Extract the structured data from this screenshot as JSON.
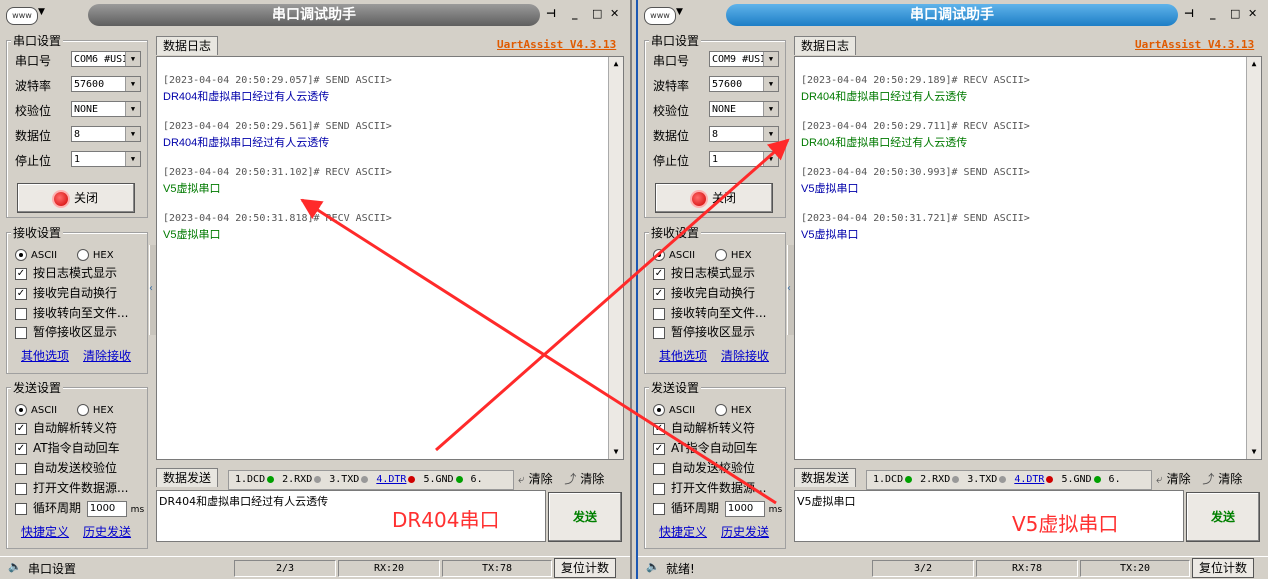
{
  "windows": {
    "left": {
      "title": "串口调试助手",
      "brand": "UartAssist V4.3.13",
      "serial": {
        "group": "串口设置",
        "port_label": "串口号",
        "port": "COM6 #USI",
        "baud_label": "波特率",
        "baud": "57600",
        "parity_label": "校验位",
        "parity": "NONE",
        "databits_label": "数据位",
        "databits": "8",
        "stopbits_label": "停止位",
        "stopbits": "1",
        "close_label": "关闭"
      },
      "recv": {
        "group": "接收设置",
        "ascii": "ASCII",
        "hex": "HEX",
        "opt1": "按日志模式显示",
        "opt2": "接收完自动换行",
        "opt3": "接收转向至文件...",
        "opt4": "暂停接收区显示",
        "link1": "其他选项",
        "link2": "清除接收"
      },
      "send": {
        "group": "发送设置",
        "ascii": "ASCII",
        "hex": "HEX",
        "opt1": "自动解析转义符",
        "opt2": "AT指令自动回车",
        "opt3": "自动发送校验位",
        "opt4": "打开文件数据源...",
        "cycle_label": "循环周期",
        "cycle_value": "1000",
        "cycle_unit": "ms",
        "link1": "快捷定义",
        "link2": "历史发送"
      },
      "log_tab": "数据日志",
      "log": [
        {
          "ts": "[2023-04-04 20:50:29.057]# SEND ASCII>",
          "msg": "DR404和虚拟串口经过有人云透传",
          "color": "#0000aa"
        },
        {
          "ts": "[2023-04-04 20:50:29.561]# SEND ASCII>",
          "msg": "DR404和虚拟串口经过有人云透传",
          "color": "#0000aa"
        },
        {
          "ts": "[2023-04-04 20:50:31.102]# RECV ASCII>",
          "msg": "V5虚拟串口",
          "color": "#007a00"
        },
        {
          "ts": "[2023-04-04 20:50:31.818]# RECV ASCII>",
          "msg": "V5虚拟串口",
          "color": "#007a00"
        }
      ],
      "send_tab": "数据发送",
      "signals": [
        "1.DCD",
        "2.RXD",
        "3.TXD",
        "4.DTR",
        "5.GND",
        "6."
      ],
      "clear1": "清除",
      "clear2": "清除",
      "send_text": "DR404和虚拟串口经过有人云透传",
      "send_btn": "发送",
      "status": {
        "left": "串口设置",
        "page": "2/3",
        "rx": "RX:20",
        "tx": "TX:78",
        "reset": "复位计数"
      },
      "overlay": "DR404串口"
    },
    "right": {
      "title": "串口调试助手",
      "brand": "UartAssist V4.3.13",
      "serial": {
        "group": "串口设置",
        "port_label": "串口号",
        "port": "COM9 #USI",
        "baud_label": "波特率",
        "baud": "57600",
        "parity_label": "校验位",
        "parity": "NONE",
        "databits_label": "数据位",
        "databits": "8",
        "stopbits_label": "停止位",
        "stopbits": "1",
        "close_label": "关闭"
      },
      "recv": {
        "group": "接收设置",
        "ascii": "ASCII",
        "hex": "HEX",
        "opt1": "按日志模式显示",
        "opt2": "接收完自动换行",
        "opt3": "接收转向至文件...",
        "opt4": "暂停接收区显示",
        "link1": "其他选项",
        "link2": "清除接收"
      },
      "send": {
        "group": "发送设置",
        "ascii": "ASCII",
        "hex": "HEX",
        "opt1": "自动解析转义符",
        "opt2": "AT指令自动回车",
        "opt3": "自动发送校验位",
        "opt4": "打开文件数据源...",
        "cycle_label": "循环周期",
        "cycle_value": "1000",
        "cycle_unit": "ms",
        "link1": "快捷定义",
        "link2": "历史发送"
      },
      "log_tab": "数据日志",
      "log": [
        {
          "ts": "[2023-04-04 20:50:29.189]# RECV ASCII>",
          "msg": "DR404和虚拟串口经过有人云透传",
          "color": "#007a00"
        },
        {
          "ts": "[2023-04-04 20:50:29.711]# RECV ASCII>",
          "msg": "DR404和虚拟串口经过有人云透传",
          "color": "#007a00"
        },
        {
          "ts": "[2023-04-04 20:50:30.993]# SEND ASCII>",
          "msg": "V5虚拟串口",
          "color": "#0000aa"
        },
        {
          "ts": "[2023-04-04 20:50:31.721]# SEND ASCII>",
          "msg": "V5虚拟串口",
          "color": "#0000aa"
        }
      ],
      "send_tab": "数据发送",
      "signals": [
        "1.DCD",
        "2.RXD",
        "3.TXD",
        "4.DTR",
        "5.GND",
        "6."
      ],
      "clear1": "清除",
      "clear2": "清除",
      "send_text": "V5虚拟串口",
      "send_btn": "发送",
      "status": {
        "left": "就绪!",
        "page": "3/2",
        "rx": "RX:78",
        "tx": "TX:20",
        "reset": "复位计数"
      },
      "overlay": "V5虚拟串口"
    }
  },
  "colors": {
    "send_text": "#0000aa",
    "recv_text": "#007a00",
    "annotation": "#ff3030",
    "brand": "#e05a00"
  }
}
